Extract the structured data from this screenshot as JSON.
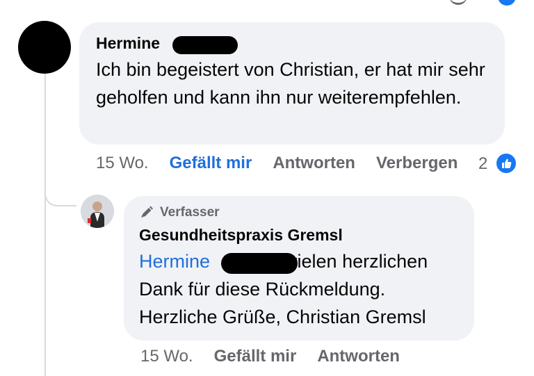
{
  "comment": {
    "author": "Hermine",
    "text": "Ich bin begeistert von Christian, er hat mir sehr geholfen und kann ihn nur weiterempfehlen.",
    "time": "15 Wo.",
    "like_label": "Gefällt mir",
    "reply_label": "Antworten",
    "hide_label": "Verbergen",
    "reaction_count": "2",
    "reaction_icon": "thumbs-up-icon"
  },
  "reply": {
    "badge_icon": "pen-icon",
    "badge_label": "Verfasser",
    "author": "Gesundheitspraxis Gremsl",
    "mention": "Hermine",
    "text": "vielen herzlichen Dank für diese Rückmeldung. Herzliche Grüße, Christian Gremsl",
    "time": "15 Wo.",
    "like_label": "Gefällt mir",
    "reply_label": "Antworten"
  },
  "colors": {
    "accent": "#216fdb",
    "bubble": "#f0f2f5",
    "meta_text": "#65676b",
    "reaction": "#1877f2"
  }
}
